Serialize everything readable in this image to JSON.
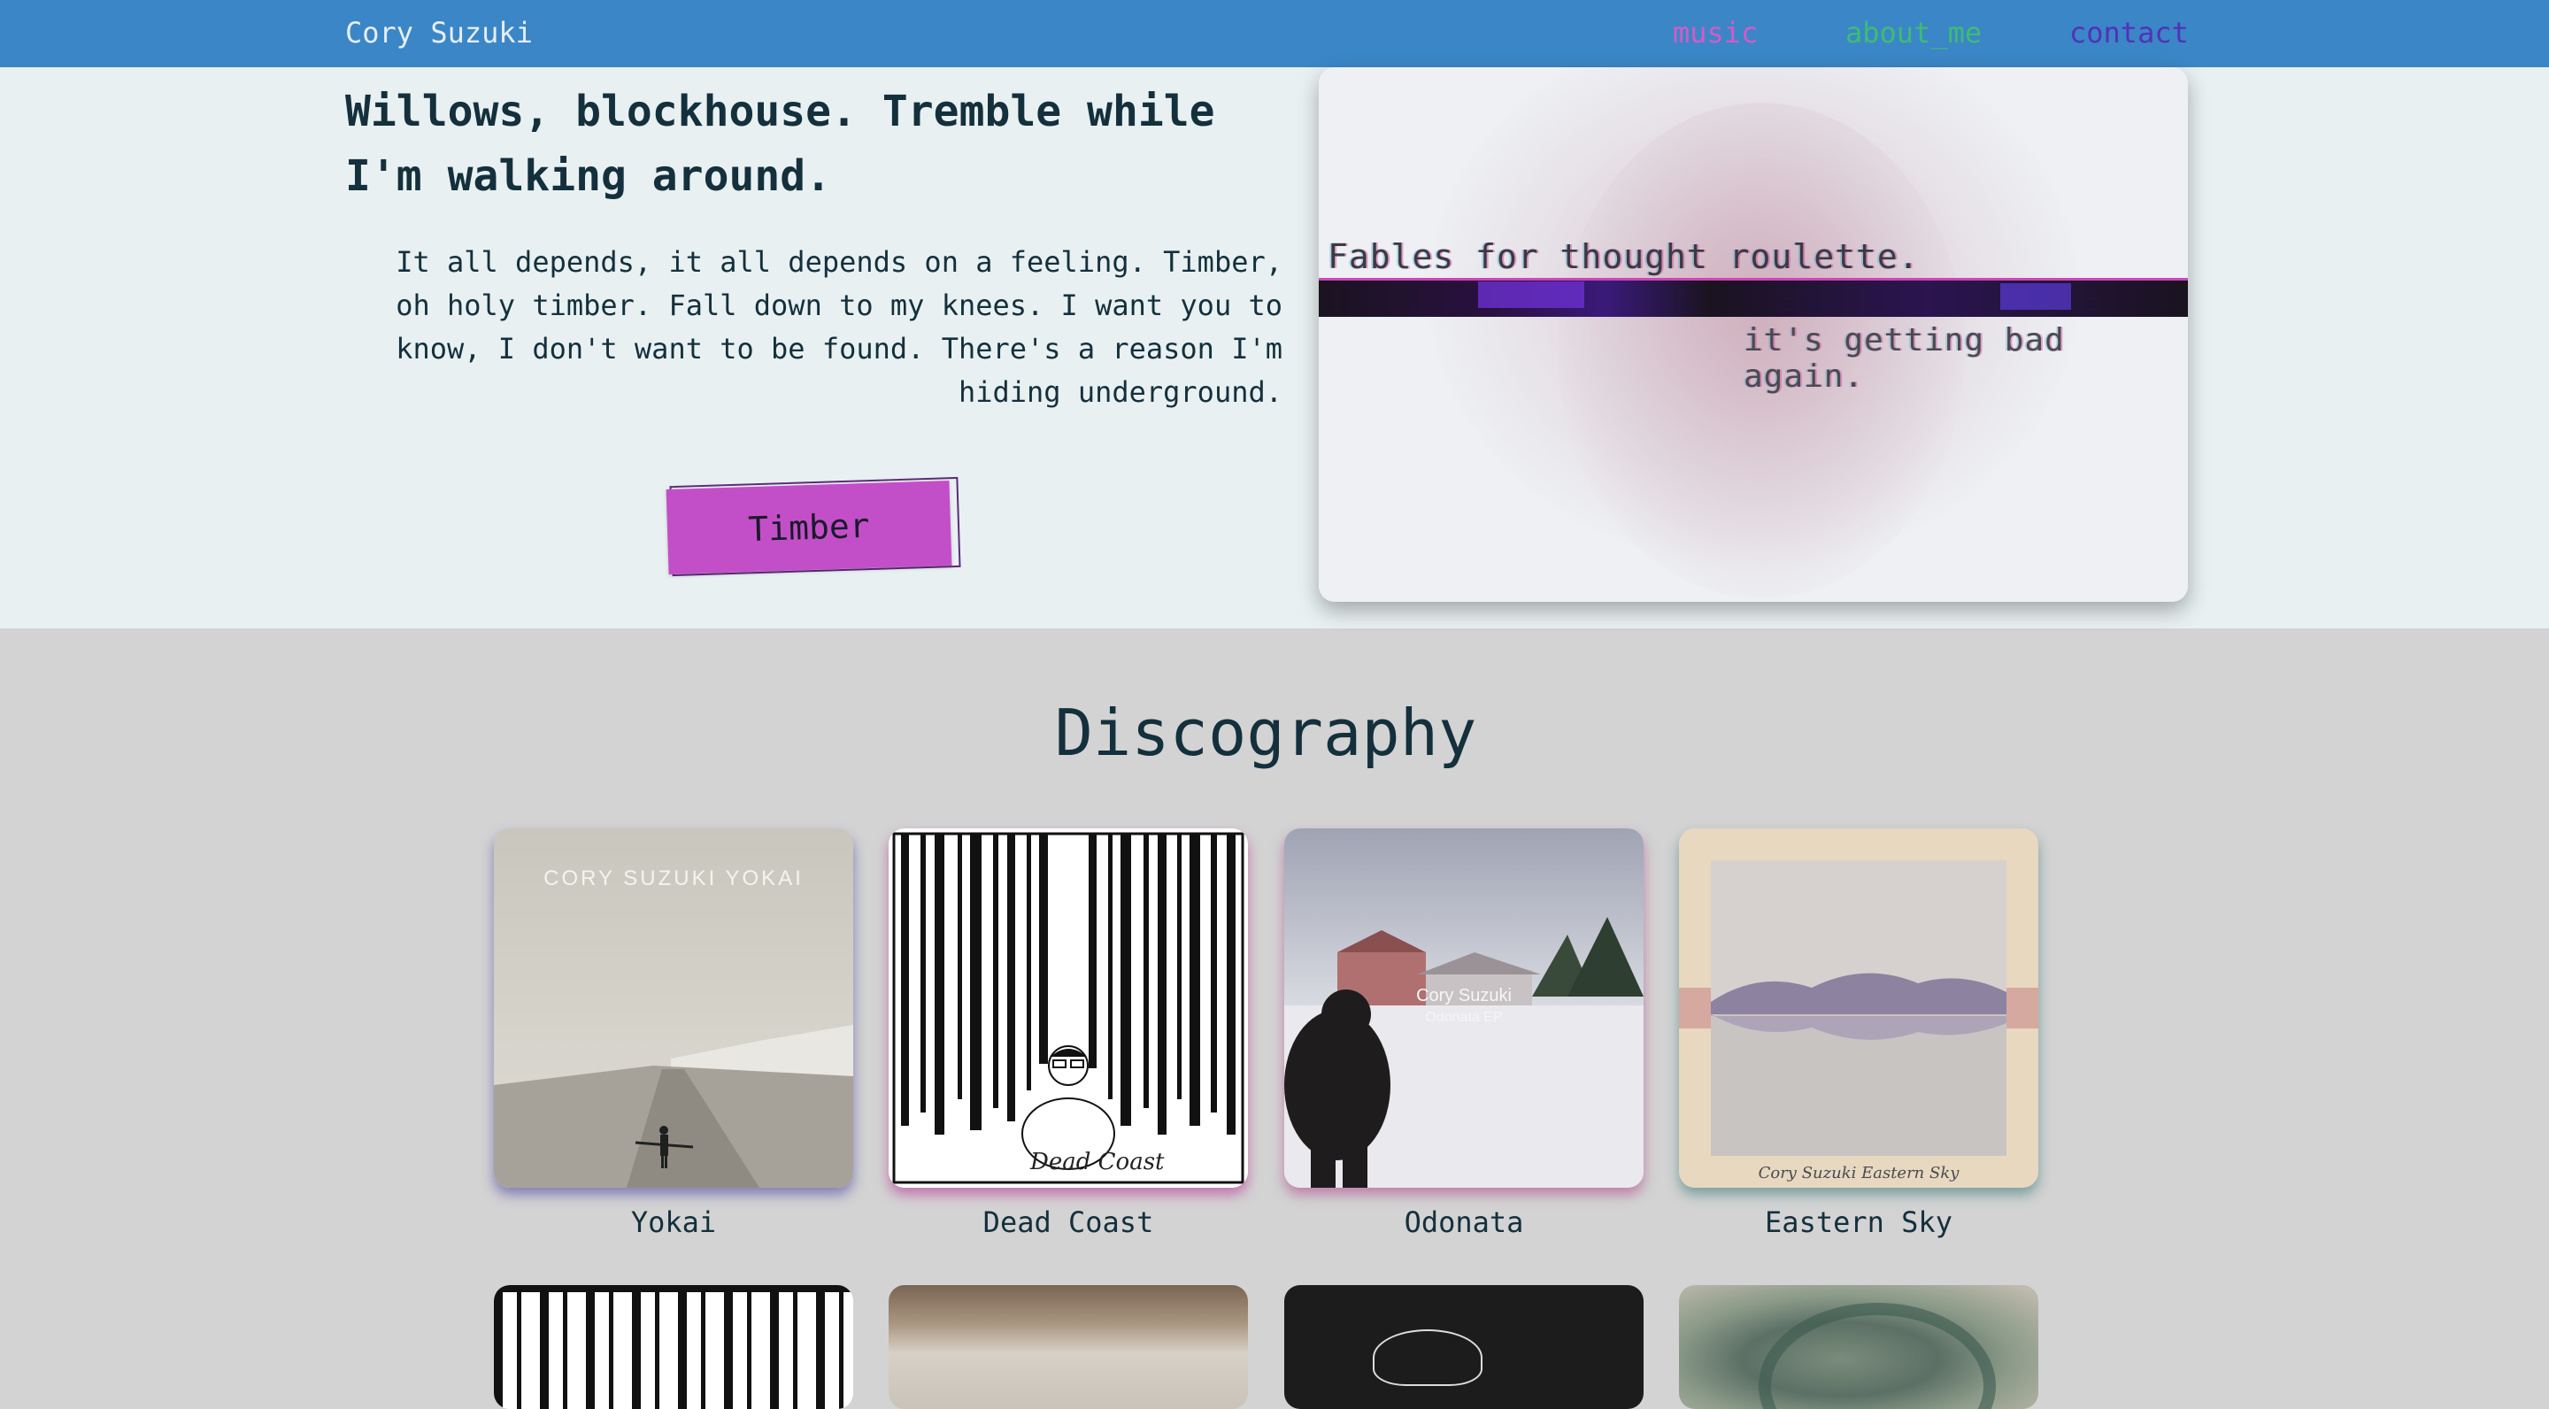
{
  "nav": {
    "brand": "Cory Suzuki",
    "links": [
      {
        "label": "music",
        "color": "#d35bc8"
      },
      {
        "label": "about_me",
        "color": "#3dbd72"
      },
      {
        "label": "contact",
        "color": "#5232b8"
      }
    ]
  },
  "hero": {
    "heading": "Willows, blockhouse. Tremble while I'm walking around.",
    "lyrics": "It all depends, it all depends on a feeling. Timber, oh holy timber. Fall down to my knees. I want you to know, I don't want to be found. There's a reason I'm hiding underground.",
    "button_label": "Timber",
    "image": {
      "overlay_line_1": "Fables for thought roulette.",
      "overlay_line_2": "it's getting bad again."
    }
  },
  "discography": {
    "title": "Discography",
    "albums": [
      {
        "title": "Yokai",
        "cover_text": "CORY SUZUKI YOKAI"
      },
      {
        "title": "Dead Coast",
        "cover_text": "Dead Coast"
      },
      {
        "title": "Odonata",
        "cover_text_1": "Cory Suzuki",
        "cover_text_2": "Odonata EP"
      },
      {
        "title": "Eastern Sky",
        "cover_text": "Cory Suzuki  Eastern Sky"
      }
    ]
  },
  "colors": {
    "nav_bg": "#3b86c6",
    "hero_bg": "#e8f0f2",
    "page_bg": "#d3d3d3",
    "button": "#c34fc8",
    "text": "#14303c"
  }
}
